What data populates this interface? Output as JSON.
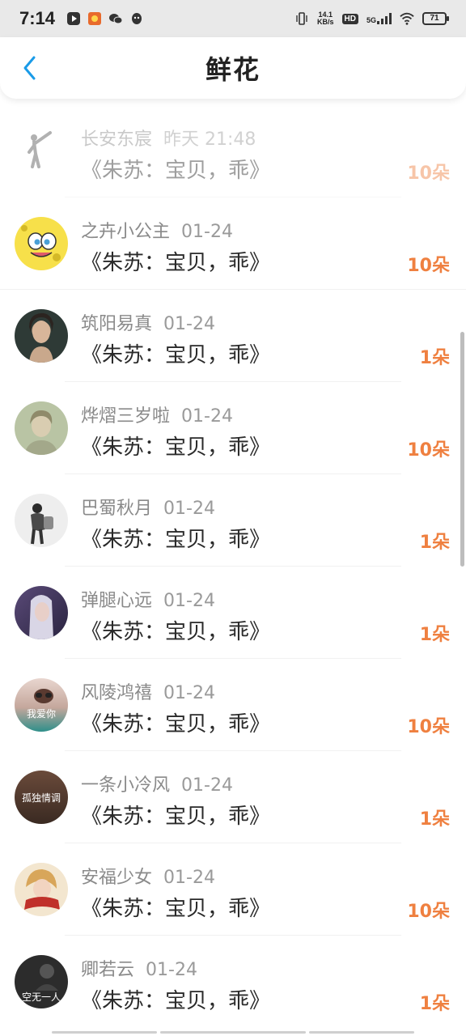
{
  "status_bar": {
    "time": "7:14",
    "net_speed_value": "14.1",
    "net_speed_unit": "KB/s",
    "hd": "HD",
    "signal": "5G",
    "battery": "71"
  },
  "header": {
    "title": "鲜花",
    "back_icon": "chevron-left-icon",
    "accent_color": "#1a9be8"
  },
  "colors": {
    "count": "#ef8040"
  },
  "list": [
    {
      "name": "长安东宸",
      "date": "昨天 21:48",
      "song": "《朱苏：宝贝，乖》",
      "count": "10朵",
      "faded": true
    },
    {
      "name": "之卉小公主",
      "date": "01-24",
      "song": "《朱苏：宝贝，乖》",
      "count": "10朵"
    },
    {
      "name": "筑阳易真",
      "date": "01-24",
      "song": "《朱苏：宝贝，乖》",
      "count": "1朵"
    },
    {
      "name": "烨熠三岁啦",
      "date": "01-24",
      "song": "《朱苏：宝贝，乖》",
      "count": "10朵"
    },
    {
      "name": "巴蜀秋月",
      "date": "01-24",
      "song": "《朱苏：宝贝，乖》",
      "count": "1朵"
    },
    {
      "name": "弹腿心远",
      "date": "01-24",
      "song": "《朱苏：宝贝，乖》",
      "count": "1朵"
    },
    {
      "name": "风陵鸿禧",
      "date": "01-24",
      "song": "《朱苏：宝贝，乖》",
      "count": "10朵",
      "avatar_text": "我爱你"
    },
    {
      "name": "一条小冷风",
      "date": "01-24",
      "song": "《朱苏：宝贝，乖》",
      "count": "1朵",
      "avatar_text": "孤独情调"
    },
    {
      "name": "安福少女",
      "date": "01-24",
      "song": "《朱苏：宝贝，乖》",
      "count": "10朵"
    },
    {
      "name": "卿若云",
      "date": "01-24",
      "song": "《朱苏：宝贝，乖》",
      "count": "1朵",
      "avatar_text": "空无一人"
    }
  ]
}
